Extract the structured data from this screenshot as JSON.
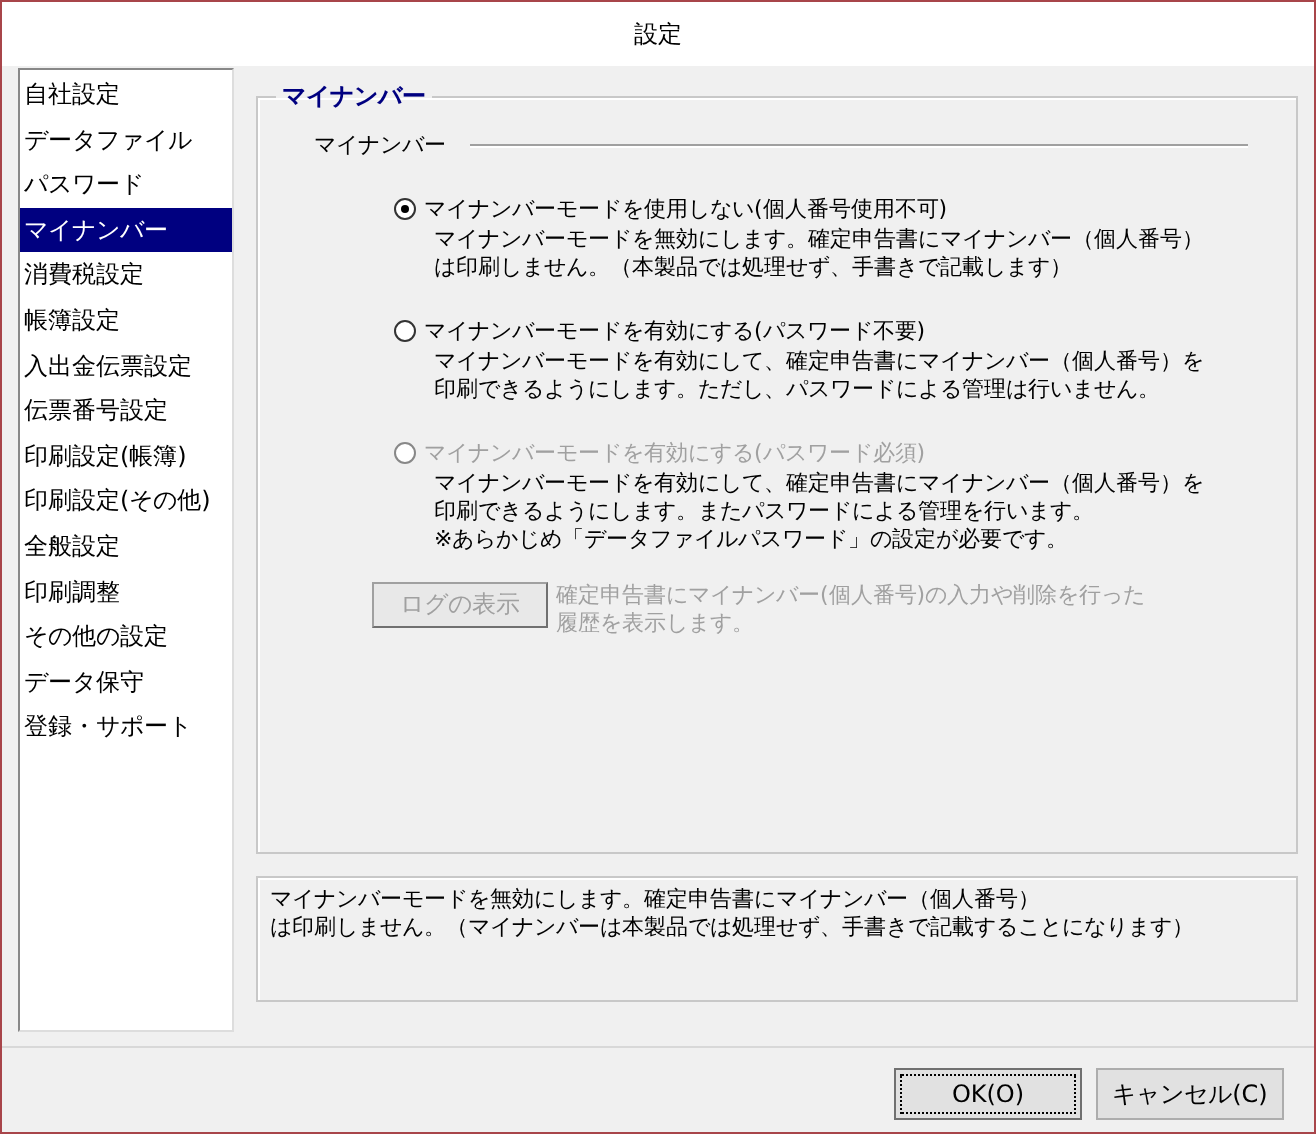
{
  "window": {
    "title": "設定"
  },
  "sidebar": {
    "items": [
      {
        "label": "自社設定",
        "selected": false
      },
      {
        "label": "データファイル",
        "selected": false
      },
      {
        "label": "パスワード",
        "selected": false
      },
      {
        "label": "マイナンバー",
        "selected": true
      },
      {
        "label": "消費税設定",
        "selected": false
      },
      {
        "label": "帳簿設定",
        "selected": false
      },
      {
        "label": "入出金伝票設定",
        "selected": false
      },
      {
        "label": "伝票番号設定",
        "selected": false
      },
      {
        "label": "印刷設定(帳簿)",
        "selected": false
      },
      {
        "label": "印刷設定(その他)",
        "selected": false
      },
      {
        "label": "全般設定",
        "selected": false
      },
      {
        "label": "印刷調整",
        "selected": false
      },
      {
        "label": "その他の設定",
        "selected": false
      },
      {
        "label": "データ保守",
        "selected": false
      },
      {
        "label": "登録・サポート",
        "selected": false
      }
    ]
  },
  "group": {
    "title": "マイナンバー",
    "section": "マイナンバー",
    "options": [
      {
        "label": "マイナンバーモードを使用しない(個人番号使用不可)",
        "selected": true,
        "disabled": false,
        "description": [
          "マイナンバーモードを無効にします。確定申告書にマイナンバー（個人番号）",
          "は印刷しません。（本製品では処理せず、手書きで記載します）"
        ]
      },
      {
        "label": "マイナンバーモードを有効にする(パスワード不要)",
        "selected": false,
        "disabled": false,
        "description": [
          "マイナンバーモードを有効にして、確定申告書にマイナンバー（個人番号）を",
          "印刷できるようにします。ただし、パスワードによる管理は行いません。"
        ]
      },
      {
        "label": "マイナンバーモードを有効にする(パスワード必須)",
        "selected": false,
        "disabled": true,
        "description": [
          "マイナンバーモードを有効にして、確定申告書にマイナンバー（個人番号）を",
          "印刷できるようにします。またパスワードによる管理を行います。",
          "※あらかじめ「データファイルパスワード」の設定が必要です。"
        ]
      }
    ],
    "log_button": {
      "label": "ログの表示",
      "disabled": true,
      "note": [
        "確定申告書にマイナンバー(個人番号)の入力や削除を行った",
        "履歴を表示します。"
      ]
    }
  },
  "info": [
    "マイナンバーモードを無効にします。確定申告書にマイナンバー（個人番号）",
    "は印刷しません。（マイナンバーは本製品では処理せず、手書きで記載することになります）"
  ],
  "buttons": [
    {
      "label": "OK(O)",
      "default": true
    },
    {
      "label": "キャンセル(C)",
      "default": false
    }
  ]
}
